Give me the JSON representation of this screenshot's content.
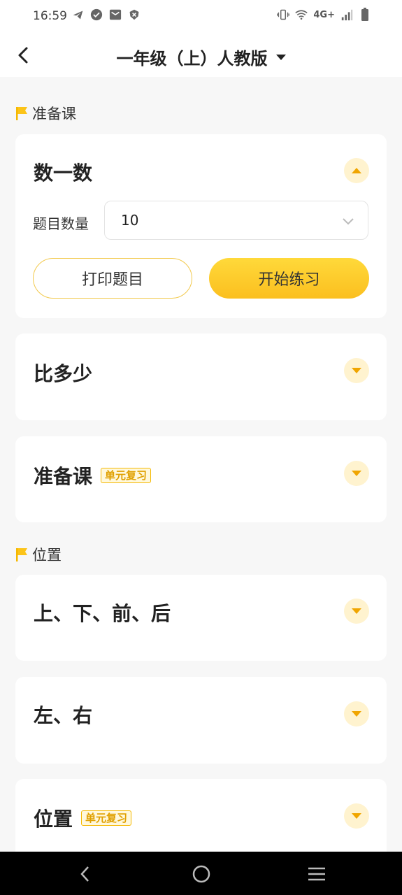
{
  "status_bar": {
    "time": "16:59",
    "network": "4G+",
    "icons_left": [
      "telegram-icon",
      "check-circle-icon",
      "mail-icon",
      "shield-icon"
    ],
    "icons_right": [
      "vibrate-icon",
      "wifi-icon",
      "signal-icon",
      "battery-icon"
    ]
  },
  "header": {
    "title": "一年级（上）人教版"
  },
  "sections": [
    {
      "label": "准备课",
      "cards": [
        {
          "title": "数一数",
          "tag": "",
          "expanded": true
        },
        {
          "title": "比多少",
          "tag": "",
          "expanded": false
        },
        {
          "title": "准备课",
          "tag": "单元复习",
          "expanded": false
        }
      ]
    },
    {
      "label": "位置",
      "cards": [
        {
          "title": "上、下、前、后",
          "tag": "",
          "expanded": false
        },
        {
          "title": "左、右",
          "tag": "",
          "expanded": false
        },
        {
          "title": "位置",
          "tag": "单元复习",
          "expanded": false
        }
      ]
    }
  ],
  "expanded_card": {
    "count_label": "题目数量",
    "count_value": "10",
    "print_label": "打印题目",
    "start_label": "开始练习"
  },
  "colors": {
    "accent": "#fbc02d",
    "accent_light": "#fff3cf",
    "tag_text": "#e0a000",
    "background": "#f7f7f7"
  }
}
